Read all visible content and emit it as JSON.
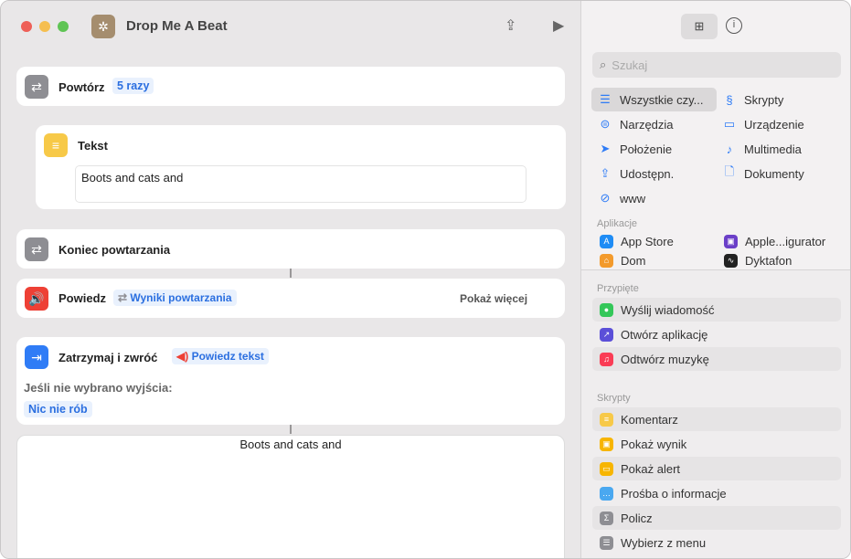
{
  "window": {
    "title": "Drop Me A Beat"
  },
  "editor": {
    "repeat": {
      "label": "Powtórz",
      "count": "5 razy"
    },
    "text": {
      "label": "Tekst",
      "value": "Boots and cats and"
    },
    "end_repeat": {
      "label": "Koniec powtarzania"
    },
    "speak": {
      "label": "Powiedz",
      "param": "Wyniki powtarzania",
      "more": "Pokaż więcej"
    },
    "stop": {
      "label": "Zatrzymaj i zwróć",
      "param": "Powiedz tekst",
      "no_output_label": "Jeśli nie wybrano wyjścia:",
      "no_output_value": "Nic nie rób"
    },
    "output": {
      "value": "Boots and cats and"
    }
  },
  "sidebar": {
    "search_placeholder": "Szukaj",
    "categories": [
      {
        "label": "Wszystkie czy...",
        "icon": "list-icon"
      },
      {
        "label": "Skrypty",
        "icon": "script-icon"
      },
      {
        "label": "Narzędzia",
        "icon": "toggle-icon"
      },
      {
        "label": "Urządzenie",
        "icon": "display-icon"
      },
      {
        "label": "Położenie",
        "icon": "location-icon"
      },
      {
        "label": "Multimedia",
        "icon": "music-note-icon"
      },
      {
        "label": "Udostępn.",
        "icon": "share-icon"
      },
      {
        "label": "Dokumenty",
        "icon": "document-icon"
      },
      {
        "label": "www",
        "icon": "compass-icon"
      }
    ],
    "apps_heading": "Aplikacje",
    "apps": [
      {
        "label": "App Store",
        "color": "#1f8cf5"
      },
      {
        "label": "Apple...igurator",
        "color": "#6b3fc8"
      },
      {
        "label": "Dom",
        "color": "#f39a2b"
      },
      {
        "label": "Dyktafon",
        "color": "#222222"
      }
    ],
    "pinned_heading": "Przypięte",
    "pinned": [
      {
        "label": "Wyślij wiadomość",
        "color": "#34c759",
        "glyph": "💬"
      },
      {
        "label": "Otwórz aplikację",
        "color": "#5b4fd8",
        "glyph": "↗"
      },
      {
        "label": "Odtwórz muzykę",
        "color": "#fa3c55",
        "glyph": "♫"
      }
    ],
    "scripts_heading": "Skrypty",
    "scripts": [
      {
        "label": "Komentarz",
        "color": "#f7c948",
        "glyph": "≡"
      },
      {
        "label": "Pokaż wynik",
        "color": "#f7b500",
        "glyph": "▣"
      },
      {
        "label": "Pokaż alert",
        "color": "#f7b500",
        "glyph": "▭"
      },
      {
        "label": "Prośba o informacje",
        "color": "#4aa8f0",
        "glyph": "…"
      },
      {
        "label": "Policz",
        "color": "#8e8e93",
        "glyph": "Σ"
      },
      {
        "label": "Wybierz z menu",
        "color": "#8e8e93",
        "glyph": "☰"
      }
    ]
  }
}
